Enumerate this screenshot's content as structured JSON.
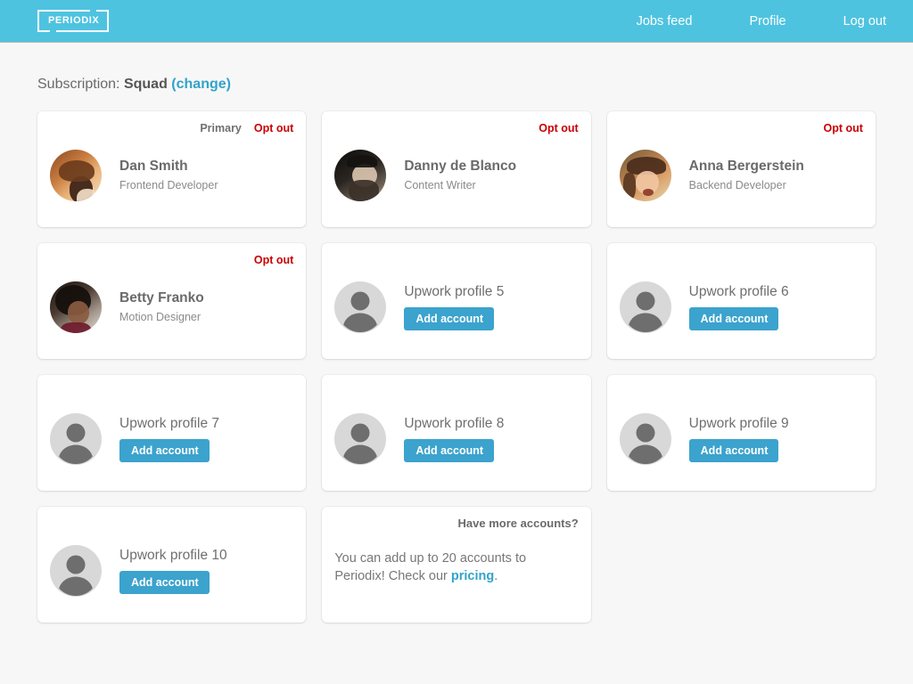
{
  "header": {
    "logo_text": "PERIODIX",
    "nav": [
      {
        "label": "Jobs feed",
        "name": "nav-jobs-feed"
      },
      {
        "label": "Profile",
        "name": "nav-profile"
      },
      {
        "label": "Log out",
        "name": "nav-log-out"
      }
    ]
  },
  "subscription": {
    "label": "Subscription:",
    "plan": "Squad",
    "change_label": "(change)"
  },
  "labels": {
    "primary": "Primary",
    "opt_out": "Opt out",
    "add_account": "Add account"
  },
  "colors": {
    "header_blue": "#4ec3e0",
    "accent_blue": "#3ba3cd",
    "link_blue": "#32a3c9",
    "opt_out_red": "#c90000",
    "page_background": "#f7f7f7",
    "avatar_placeholder": "#d8d8d8"
  },
  "cards": [
    {
      "type": "account",
      "name": "Dan Smith",
      "role": "Frontend Developer",
      "primary": true,
      "opt_out": true,
      "avatar": "photo-dan-smith"
    },
    {
      "type": "account",
      "name": "Danny de Blanco",
      "role": "Content Writer",
      "primary": false,
      "opt_out": true,
      "avatar": "photo-danny-de-blanco"
    },
    {
      "type": "account",
      "name": "Anna Bergerstein",
      "role": "Backend Developer",
      "primary": false,
      "opt_out": true,
      "avatar": "photo-anna-bergerstein"
    },
    {
      "type": "account",
      "name": "Betty Franko",
      "role": "Motion Designer",
      "primary": false,
      "opt_out": true,
      "avatar": "photo-betty-franko"
    },
    {
      "type": "empty",
      "name": "Upwork profile 5",
      "button": "Add account",
      "avatar": "placeholder-avatar-icon"
    },
    {
      "type": "empty",
      "name": "Upwork profile 6",
      "button": "Add account",
      "avatar": "placeholder-avatar-icon"
    },
    {
      "type": "empty",
      "name": "Upwork profile 7",
      "button": "Add account",
      "avatar": "placeholder-avatar-icon"
    },
    {
      "type": "empty",
      "name": "Upwork profile 8",
      "button": "Add account",
      "avatar": "placeholder-avatar-icon"
    },
    {
      "type": "empty",
      "name": "Upwork profile 9",
      "button": "Add account",
      "avatar": "placeholder-avatar-icon"
    },
    {
      "type": "empty",
      "name": "Upwork profile 10",
      "button": "Add account",
      "avatar": "placeholder-avatar-icon"
    },
    {
      "type": "info",
      "title": "Have more accounts?",
      "text_before": "You can add up to 20 accounts to Periodix! Check our ",
      "link": "pricing",
      "text_after": "."
    }
  ]
}
